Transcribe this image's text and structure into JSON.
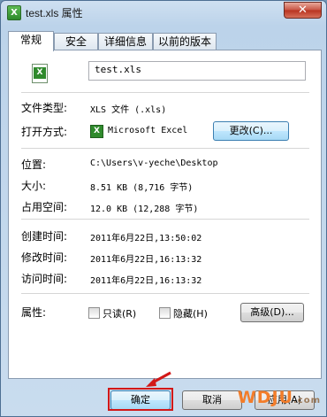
{
  "window": {
    "title": "test.xls 属性",
    "close_symbol": "✕"
  },
  "tabs": [
    "常规",
    "安全",
    "详细信息",
    "以前的版本"
  ],
  "general": {
    "file_name": "test.xls",
    "type_label": "文件类型:",
    "type_value": "XLS 文件 (.xls)",
    "opens_label": "打开方式:",
    "opens_value": "Microsoft Excel",
    "change_button": "更改(C)...",
    "location_label": "位置:",
    "location_value": "C:\\Users\\v-yeche\\Desktop",
    "size_label": "大小:",
    "size_value": "8.51 KB (8,716 字节)",
    "size_on_disk_label": "占用空间:",
    "size_on_disk_value": "12.0 KB (12,288 字节)",
    "created_label": "创建时间:",
    "created_value": "2011年6月22日,13:50:02",
    "modified_label": "修改时间:",
    "modified_value": "2011年6月22日,16:13:32",
    "accessed_label": "访问时间:",
    "accessed_value": "2011年6月22日,16:13:32",
    "attributes_label": "属性:",
    "readonly_label": "只读(R)",
    "hidden_label": "隐藏(H)",
    "advanced_button": "高级(D)..."
  },
  "footer": {
    "ok": "确定",
    "cancel": "取消",
    "apply": "应用(A)"
  },
  "watermark": {
    "main": "WDJU",
    "sub": ".com"
  }
}
